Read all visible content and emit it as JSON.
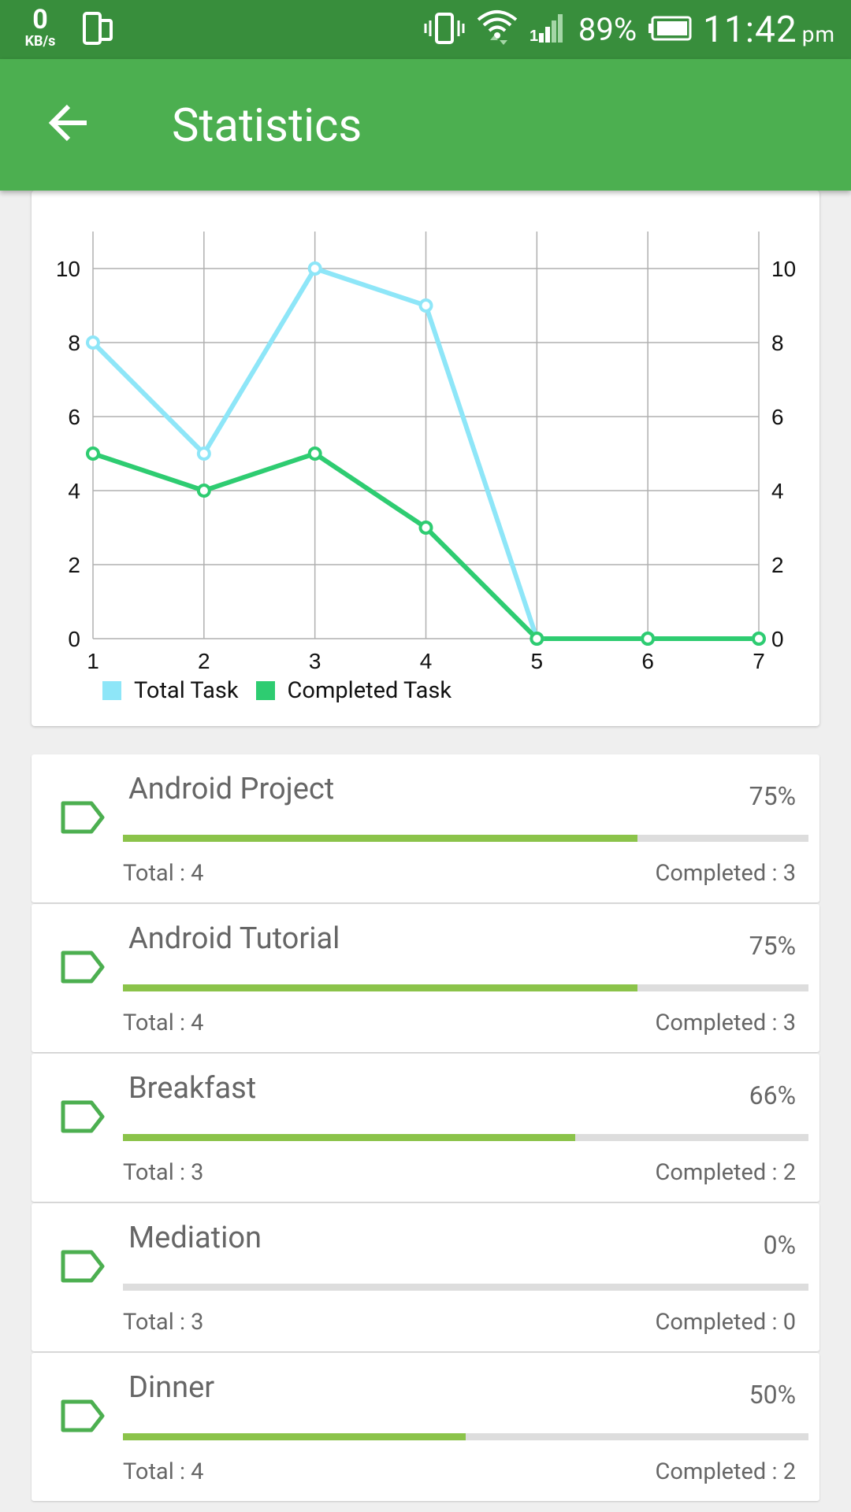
{
  "status_bar": {
    "net_speed": "0",
    "net_unit": "KB/s",
    "battery": "89%",
    "time": "11:42",
    "ampm": "pm"
  },
  "app_bar": {
    "title": "Statistics"
  },
  "colors": {
    "status": "#388e3c",
    "appbar": "#4caf50",
    "total_line": "#8ee6f8",
    "completed_line": "#2ecc71",
    "progress": "#8bc34a"
  },
  "chart_data": {
    "type": "line",
    "x": [
      1,
      2,
      3,
      4,
      5,
      6,
      7
    ],
    "series": [
      {
        "name": "Total Task",
        "color": "#8ee6f8",
        "values": [
          8,
          5,
          10,
          9,
          0,
          0,
          0
        ]
      },
      {
        "name": "Completed Task",
        "color": "#2ecc71",
        "values": [
          5,
          4,
          5,
          3,
          0,
          0,
          0
        ]
      }
    ],
    "y_ticks": [
      0,
      2,
      4,
      6,
      8,
      10
    ],
    "ylim": [
      0,
      11
    ],
    "grid": true,
    "legend": "bottom-left"
  },
  "projects": [
    {
      "name": "Android Project",
      "percent": "75%",
      "progress": 0.75,
      "total": "Total : 4",
      "completed": "Completed : 3"
    },
    {
      "name": "Android Tutorial",
      "percent": "75%",
      "progress": 0.75,
      "total": "Total : 4",
      "completed": "Completed : 3"
    },
    {
      "name": "Breakfast",
      "percent": "66%",
      "progress": 0.66,
      "total": "Total : 3",
      "completed": "Completed : 2"
    },
    {
      "name": "Mediation",
      "percent": "0%",
      "progress": 0,
      "total": "Total : 3",
      "completed": "Completed : 0"
    },
    {
      "name": "Dinner",
      "percent": "50%",
      "progress": 0.5,
      "total": "Total : 4",
      "completed": "Completed : 2"
    }
  ]
}
